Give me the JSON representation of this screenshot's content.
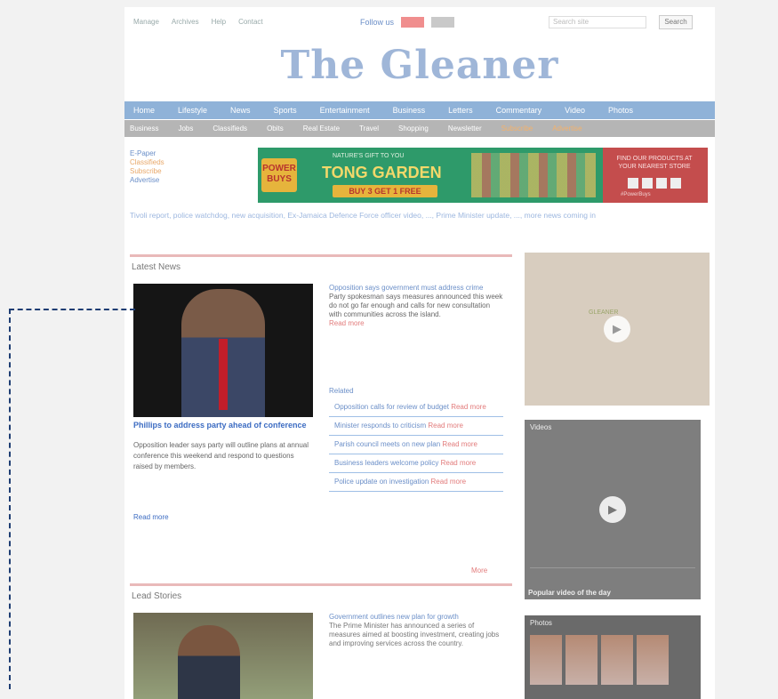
{
  "topbar": {
    "links": [
      "Manage",
      "Archives",
      "Help",
      "Contact"
    ],
    "follow_label": "Follow us",
    "search_placeholder": "Search site",
    "search_button": "Search"
  },
  "masthead": {
    "logo": "The Gleaner"
  },
  "nav_primary": [
    "Home",
    "Lifestyle",
    "News",
    "Sports",
    "Entertainment",
    "Business",
    "Letters",
    "Commentary",
    "Video",
    "Photos"
  ],
  "nav_secondary": [
    "Business",
    "Jobs",
    "Classifieds",
    "Obits",
    "Real Estate",
    "Travel",
    "Shopping",
    "Newsletter",
    "Subscribe",
    "Advertise"
  ],
  "quicklinks": [
    "E-Paper",
    "Classifieds",
    "Subscribe",
    "Advertise"
  ],
  "ad": {
    "badge": "POWER BUYS",
    "headline": "TONG GARDEN",
    "sub": "NATURE'S GIFT TO YOU",
    "cta": "BUY 3 GET 1 FREE",
    "right_text": "FIND OUR PRODUCTS AT YOUR NEAREST STORE",
    "right_footer": "#PowerBuys"
  },
  "ticker": "Tivoli report, police watchdog, new acquisition, Ex-Jamaica Defence Force officer video, ..., Prime Minister update, ..., more news coming in",
  "latest": {
    "header": "Latest News",
    "lead_title": "Phillips to address party ahead of conference",
    "lead_body": "Opposition leader says party will outline plans at annual conference this weekend and respond to questions raised by members.",
    "lead_more": "Read more",
    "col2_title": "Opposition says government must address crime",
    "col2_body": "Party spokesman says measures announced this week do not go far enough and calls for new consultation with communities across the island.",
    "col2_more": "Read more",
    "related_header": "Related",
    "related": [
      {
        "text": "Opposition calls for review of budget",
        "tag": "Read more"
      },
      {
        "text": "Minister responds to criticism",
        "tag": "Read more"
      },
      {
        "text": "Parish council meets on new plan",
        "tag": "Read more"
      },
      {
        "text": "Business leaders welcome policy",
        "tag": "Read more"
      },
      {
        "text": "Police update on investigation",
        "tag": "Read more"
      }
    ],
    "more_label": "More"
  },
  "lead_stories": {
    "header": "Lead Stories",
    "title": "Government outlines new plan for growth",
    "body": "The Prime Minister has announced a series of measures aimed at boosting investment, creating jobs and improving services across the country."
  },
  "right": {
    "video1_mark": "GLEANER",
    "video2_label": "Videos",
    "video2_caption": "Popular video of the day",
    "gallery_label": "Photos"
  }
}
